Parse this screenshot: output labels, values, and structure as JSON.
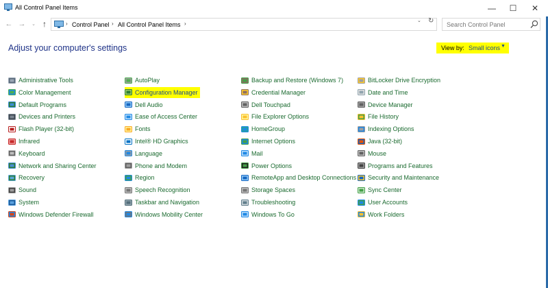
{
  "window": {
    "title": "All Control Panel Items",
    "minimize_glyph": "—",
    "maximize_glyph": "☐",
    "close_glyph": "✕"
  },
  "nav": {
    "back_glyph": "←",
    "forward_glyph": "→",
    "recent_glyph": "⌄",
    "up_glyph": "↑"
  },
  "address": {
    "crumb_separator": "›",
    "crumbs": [
      "Control Panel",
      "All Control Panel Items"
    ],
    "dropdown_glyph": "⌄",
    "refresh_glyph": "↻"
  },
  "search": {
    "placeholder": "Search Control Panel"
  },
  "header": {
    "title": "Adjust your computer's settings",
    "view_by_label": "View by:",
    "view_by_value": "Small icons",
    "view_by_caret": "▼"
  },
  "colors": {
    "link_green": "#1a6a2f",
    "heading_blue": "#1e3287",
    "highlight_yellow": "#ffff00",
    "window_border": "#2a6aa8"
  },
  "items": {
    "col1": [
      {
        "label": "Administrative Tools",
        "icon": "admin-tools-icon"
      },
      {
        "label": "Color Management",
        "icon": "color-management-icon"
      },
      {
        "label": "Default Programs",
        "icon": "default-programs-icon"
      },
      {
        "label": "Devices and Printers",
        "icon": "devices-printers-icon"
      },
      {
        "label": "Flash Player (32-bit)",
        "icon": "flash-player-icon"
      },
      {
        "label": "Infrared",
        "icon": "infrared-icon"
      },
      {
        "label": "Keyboard",
        "icon": "keyboard-icon"
      },
      {
        "label": "Network and Sharing Center",
        "icon": "network-icon"
      },
      {
        "label": "Recovery",
        "icon": "recovery-icon"
      },
      {
        "label": "Sound",
        "icon": "sound-icon"
      },
      {
        "label": "System",
        "icon": "system-icon"
      },
      {
        "label": "Windows Defender Firewall",
        "icon": "firewall-icon"
      }
    ],
    "col2": [
      {
        "label": "AutoPlay",
        "icon": "autoplay-icon"
      },
      {
        "label": "Configuration Manager",
        "icon": "configuration-manager-icon",
        "highlighted": true
      },
      {
        "label": "Dell Audio",
        "icon": "dell-audio-icon"
      },
      {
        "label": "Ease of Access Center",
        "icon": "ease-of-access-icon"
      },
      {
        "label": "Fonts",
        "icon": "fonts-icon"
      },
      {
        "label": "Intel® HD Graphics",
        "icon": "intel-graphics-icon"
      },
      {
        "label": "Language",
        "icon": "language-icon"
      },
      {
        "label": "Phone and Modem",
        "icon": "phone-modem-icon"
      },
      {
        "label": "Region",
        "icon": "region-icon"
      },
      {
        "label": "Speech Recognition",
        "icon": "speech-recognition-icon"
      },
      {
        "label": "Taskbar and Navigation",
        "icon": "taskbar-icon"
      },
      {
        "label": "Windows Mobility Center",
        "icon": "mobility-center-icon"
      }
    ],
    "col3": [
      {
        "label": "Backup and Restore (Windows 7)",
        "icon": "backup-restore-icon"
      },
      {
        "label": "Credential Manager",
        "icon": "credential-manager-icon"
      },
      {
        "label": "Dell Touchpad",
        "icon": "touchpad-icon"
      },
      {
        "label": "File Explorer Options",
        "icon": "file-explorer-options-icon"
      },
      {
        "label": "HomeGroup",
        "icon": "homegroup-icon"
      },
      {
        "label": "Internet Options",
        "icon": "internet-options-icon"
      },
      {
        "label": "Mail",
        "icon": "mail-icon"
      },
      {
        "label": "Power Options",
        "icon": "power-options-icon"
      },
      {
        "label": "RemoteApp and Desktop Connections",
        "icon": "remoteapp-icon"
      },
      {
        "label": "Storage Spaces",
        "icon": "storage-spaces-icon"
      },
      {
        "label": "Troubleshooting",
        "icon": "troubleshooting-icon"
      },
      {
        "label": "Windows To Go",
        "icon": "windows-to-go-icon"
      }
    ],
    "col4": [
      {
        "label": "BitLocker Drive Encryption",
        "icon": "bitlocker-icon"
      },
      {
        "label": "Date and Time",
        "icon": "date-time-icon"
      },
      {
        "label": "Device Manager",
        "icon": "device-manager-icon"
      },
      {
        "label": "File History",
        "icon": "file-history-icon"
      },
      {
        "label": "Indexing Options",
        "icon": "indexing-options-icon"
      },
      {
        "label": "Java (32-bit)",
        "icon": "java-icon"
      },
      {
        "label": "Mouse",
        "icon": "mouse-icon"
      },
      {
        "label": "Programs and Features",
        "icon": "programs-features-icon"
      },
      {
        "label": "Security and Maintenance",
        "icon": "security-maintenance-icon"
      },
      {
        "label": "Sync Center",
        "icon": "sync-center-icon"
      },
      {
        "label": "User Accounts",
        "icon": "user-accounts-icon"
      },
      {
        "label": "Work Folders",
        "icon": "work-folders-icon"
      }
    ]
  }
}
